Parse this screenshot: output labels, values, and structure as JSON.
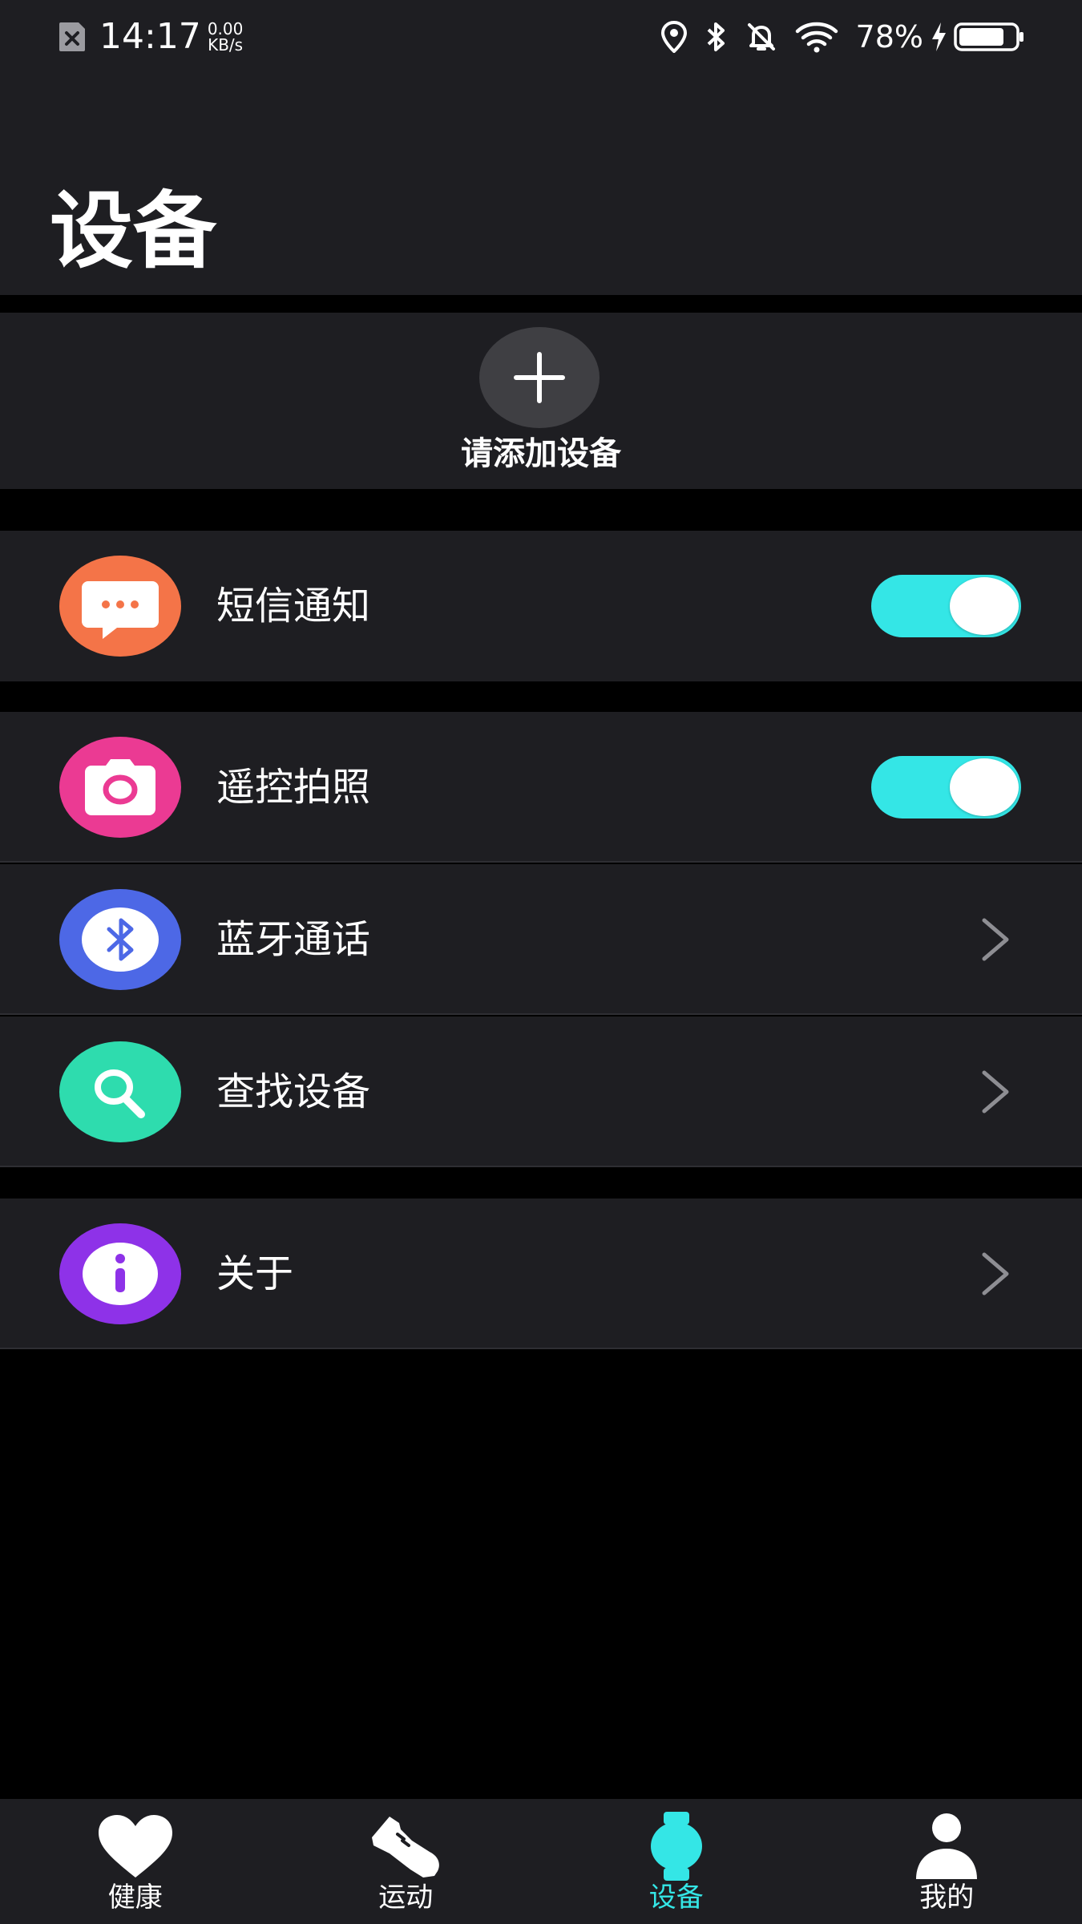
{
  "status_bar": {
    "time": "14:17",
    "speed_value": "0.00",
    "speed_unit": "KB/s",
    "battery_percent": "78%",
    "icons": [
      "sim-off-icon",
      "location-icon",
      "bluetooth-icon",
      "mute-bell-icon",
      "wifi-icon",
      "charging-icon",
      "battery-icon"
    ]
  },
  "header": {
    "title": "设备"
  },
  "add_device": {
    "label": "请添加设备",
    "icon": "plus-icon"
  },
  "settings": {
    "sms_notification": {
      "label": "短信通知",
      "enabled": true,
      "icon": "message-icon",
      "icon_color": "#f47448"
    },
    "remote_camera": {
      "label": "遥控拍照",
      "enabled": true,
      "icon": "camera-icon",
      "icon_color": "#eb3a93"
    },
    "bluetooth_call": {
      "label": "蓝牙通话",
      "icon": "bluetooth-icon",
      "icon_color": "#4d68e6"
    },
    "find_device": {
      "label": "查找设备",
      "icon": "search-icon",
      "icon_color": "#2edcae"
    },
    "about": {
      "label": "关于",
      "icon": "info-icon",
      "icon_color": "#8e32e8"
    }
  },
  "bottom_nav": {
    "items": [
      {
        "label": "健康",
        "icon": "heart-icon",
        "active": false
      },
      {
        "label": "运动",
        "icon": "shoe-icon",
        "active": false
      },
      {
        "label": "设备",
        "icon": "watch-icon",
        "active": true
      },
      {
        "label": "我的",
        "icon": "person-icon",
        "active": false
      }
    ]
  },
  "colors": {
    "accent": "#34e6e6",
    "background": "#000000",
    "card": "#1e1e22"
  }
}
